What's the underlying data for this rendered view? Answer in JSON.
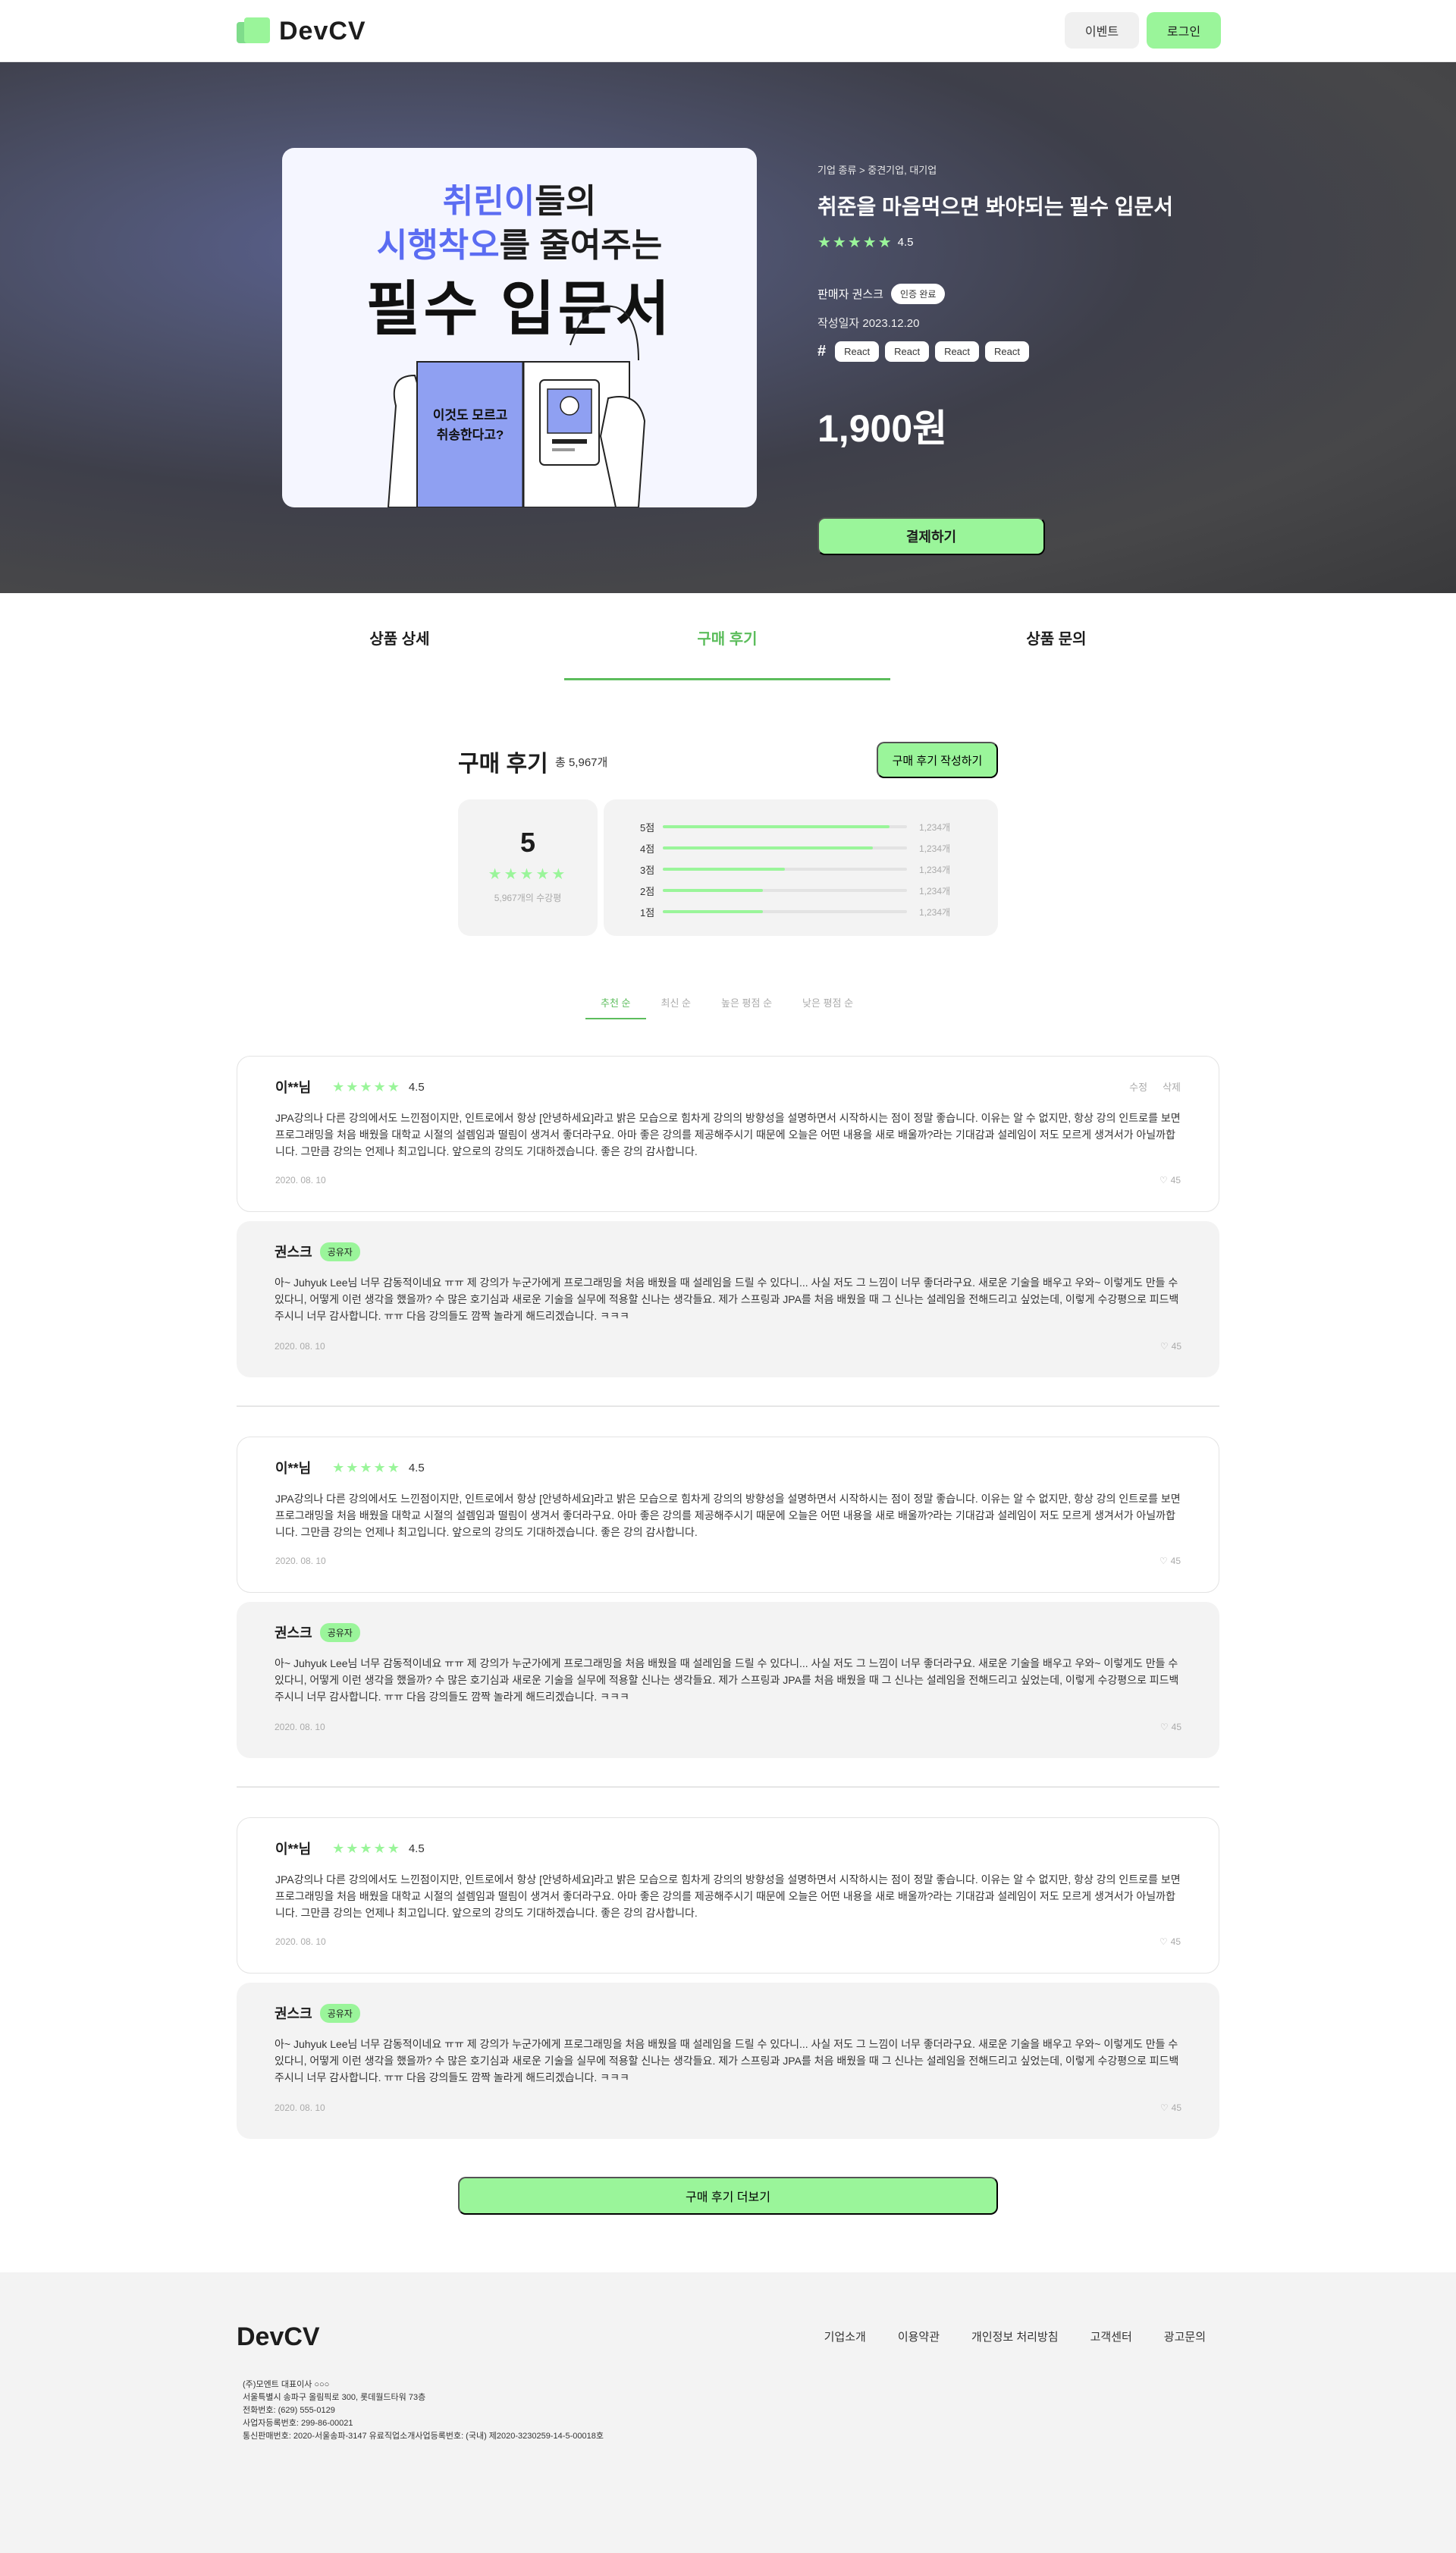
{
  "header": {
    "logo": "DevCV",
    "event_label": "이벤트",
    "login_label": "로그인"
  },
  "product": {
    "cover": {
      "line1_a": "취린이",
      "line1_b": "들의",
      "line2_a": "시행착오",
      "line2_b": "를 줄여주는",
      "line3": "필수 입문서",
      "bubble": "이것도 모르고 취송한다고?"
    },
    "breadcrumb": "기업 종류 > 중견기업, 대기업",
    "title": "취준을 마음먹으면 봐야되는 필수 입문서",
    "stars": "★★★★★",
    "rating": "4.5",
    "seller_label": "판매자 권스크",
    "cert_label": "인증 완료",
    "date_label": "작성일자 2023.12.20",
    "tags": [
      "React",
      "React",
      "React",
      "React"
    ],
    "price": "1,900원",
    "pay_label": "결제하기"
  },
  "tabs": [
    "상품 상세",
    "구매 후기",
    "상품 문의"
  ],
  "reviews_summary": {
    "title": "구매 후기",
    "total": "총 5,967개",
    "write_label": "구매 후기 작성하기",
    "average": "5",
    "stars": "★★★★★",
    "count_label": "5,967개의 수강평",
    "distribution": [
      {
        "label": "5점",
        "fraction": 0.93,
        "count": "1,234개"
      },
      {
        "label": "4점",
        "fraction": 0.86,
        "count": "1,234개"
      },
      {
        "label": "3점",
        "fraction": 0.5,
        "count": "1,234개"
      },
      {
        "label": "2점",
        "fraction": 0.41,
        "count": "1,234개"
      },
      {
        "label": "1점",
        "fraction": 0.41,
        "count": "1,234개"
      }
    ]
  },
  "sort": [
    "추천 순",
    "최신 순",
    "높은 평점 순",
    "낮은 평점 순"
  ],
  "review": {
    "name": "이**님",
    "stars": "★★★★★",
    "score": "4.5",
    "edit": "수정",
    "delete": "삭제",
    "body": "JPA강의나 다른 강의에서도 느낀점이지만, 인트로에서 항상 [안녕하세요]라고 밝은 모습으로 힘차게 강의의 방향성을 설명하면서 시작하시는 점이 정말 좋습니다. 이유는 알 수 없지만, 항상 강의 인트로를 보면 프로그래밍을 처음 배웠을 대학교 시절의 설렘임과 떨림이 생겨서 좋더라구요. 아마 좋은 강의를 제공해주시기 때문에 오늘은 어떤 내용을 새로 배울까?라는 기대감과 설레임이 저도 모르게 생겨서가 아닐까합니다. 그만큼 강의는 언제나 최고입니다. 앞으로의 강의도 기대하겠습니다. 좋은 강의 감사합니다.",
    "date": "2020. 08. 10",
    "likes": "45"
  },
  "reply": {
    "name": "권스크",
    "badge": "공유자",
    "body": "아~ Juhyuk Lee님 너무 감동적이네요 ㅠㅠ 제 강의가 누군가에게 프로그래밍을 처음 배웠을 때 설레임을 드릴 수 있다니... 사실 저도 그 느낌이 너무 좋더라구요. 새로운 기술을 배우고 우와~ 이렇게도 만들 수 있다니, 어떻게 이런 생각을 했을까? 수 많은 호기심과 새로운 기술을 실무에 적용할 신나는 생각들요. 제가 스프링과 JPA를 처음 배웠을 때 그 신나는 설레임을 전해드리고 싶었는데, 이렇게 수강평으로 피드백 주시니 너무 감사합니다. ㅠㅠ 다음 강의들도 깜짝 놀라게 해드리겠습니다. ㅋㅋㅋ",
    "date": "2020. 08. 10",
    "likes": "45"
  },
  "more_label": "구매 후기 더보기",
  "footer": {
    "logo": "DevCV",
    "links": [
      "기업소개",
      "이용약관",
      "개인정보 처리방침",
      "고객센터",
      "광고문의"
    ],
    "info": [
      "(주)모엔트   대표이사 ○○○",
      "서울특별시 송파구 올림픽로 300, 롯데월드타워 73층",
      "전화번호: (629) 555-0129",
      "사업자등록번호: 299-86-00021",
      "통신판매번호: 2020-서울송파-3147  유료직업소개사업등록번호: (국내) 제2020-3230259-14-5-00018호"
    ]
  },
  "colors": {
    "accent": "#9af59a",
    "accent_text": "#5cbd5c",
    "cover_blue": "#5b6cf2"
  }
}
